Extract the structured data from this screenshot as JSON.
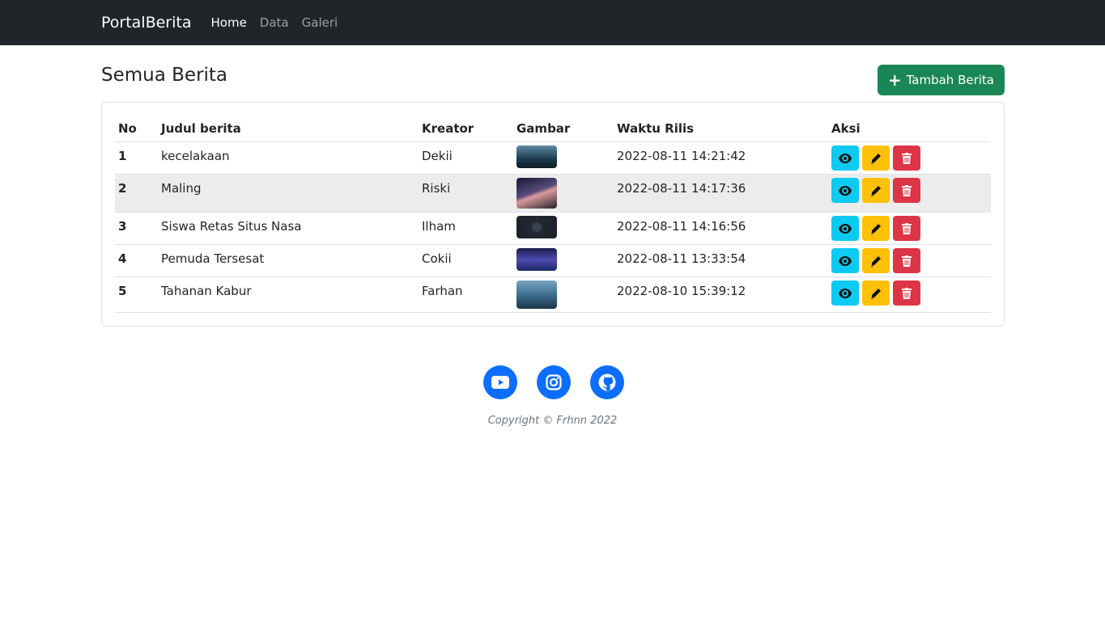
{
  "navbar": {
    "brand": "PortalBerita",
    "links": [
      "Home",
      "Data",
      "Galeri"
    ]
  },
  "page": {
    "title": "Semua Berita",
    "add_button": "Tambah Berita"
  },
  "table": {
    "headers": [
      "No",
      "Judul berita",
      "Kreator",
      "Gambar",
      "Waktu Rilis",
      "Aksi"
    ],
    "rows": [
      {
        "no": "1",
        "judul": "kecelakaan",
        "kreator": "Dekii",
        "waktu": "2022-08-11 14:21:42"
      },
      {
        "no": "2",
        "judul": "Maling",
        "kreator": "Riski",
        "waktu": "2022-08-11 14:17:36"
      },
      {
        "no": "3",
        "judul": "Siswa Retas Situs Nasa",
        "kreator": "Ilham",
        "waktu": "2022-08-11 14:16:56"
      },
      {
        "no": "4",
        "judul": "Pemuda Tersesat",
        "kreator": "Cokii",
        "waktu": "2022-08-11 13:33:54"
      },
      {
        "no": "5",
        "judul": "Tahanan Kabur",
        "kreator": "Farhan",
        "waktu": "2022-08-10 15:39:12"
      }
    ]
  },
  "footer": {
    "social_icons": [
      "youtube-icon",
      "instagram-icon",
      "github-icon"
    ],
    "copyright": "Copyright © Frhnn 2022"
  },
  "colors": {
    "navbar": "#212529",
    "primary": "#0d6efd",
    "success": "#198754",
    "info": "#0dcaf0",
    "warning": "#ffc107",
    "danger": "#dc3545"
  }
}
